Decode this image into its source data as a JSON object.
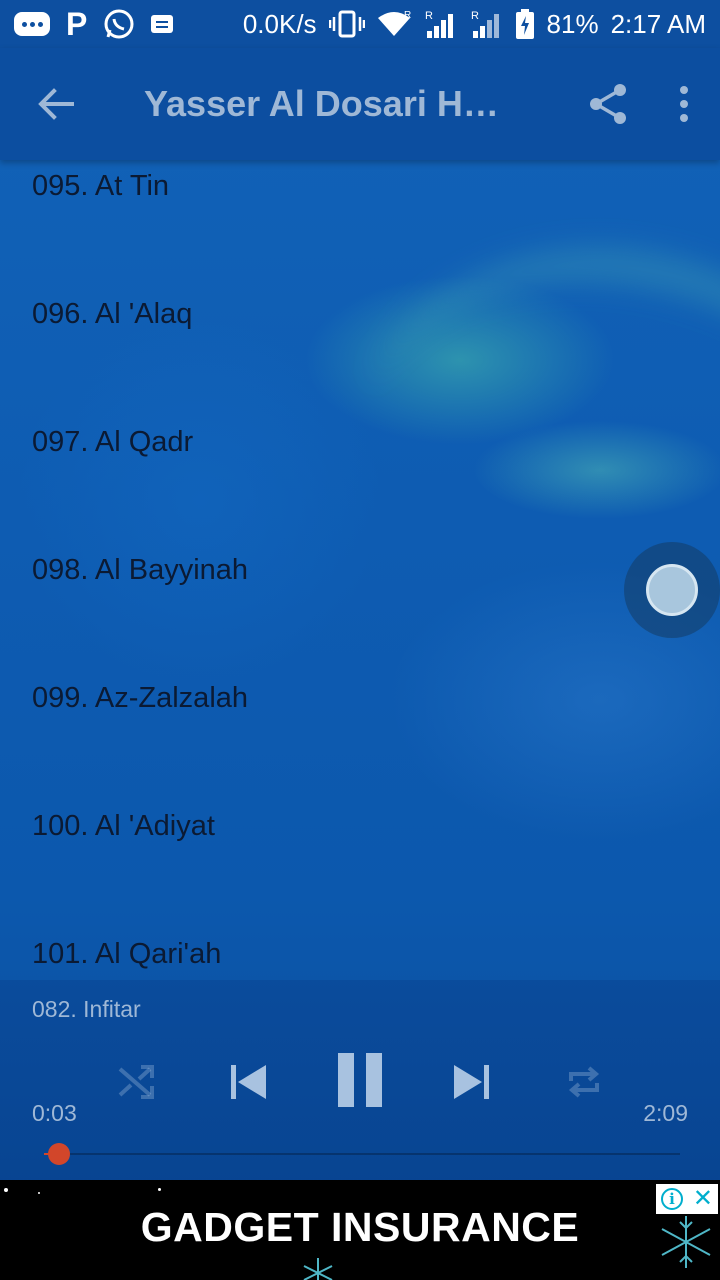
{
  "status_bar": {
    "net_speed": "0.0K/s",
    "battery": "81%",
    "time": "2:17 AM",
    "icons": [
      "chat-icon",
      "p-icon",
      "whatsapp-icon",
      "message-icon",
      "vibrate-icon",
      "wifi-icon",
      "signal-icon",
      "signal-icon",
      "battery-icon"
    ],
    "roaming_marks": [
      "R",
      "R"
    ]
  },
  "app_bar": {
    "title": "Yasser Al Dosari Ho…",
    "back_icon": "arrow-left-icon",
    "share_icon": "share-icon",
    "more_icon": "more-vert-icon"
  },
  "tracks": [
    {
      "label": "095. At Tin"
    },
    {
      "label": "096. Al 'Alaq"
    },
    {
      "label": "097. Al Qadr"
    },
    {
      "label": "098. Al Bayyinah"
    },
    {
      "label": "099. Az-Zalzalah"
    },
    {
      "label": "100. Al 'Adiyat"
    },
    {
      "label": "101. Al Qari'ah"
    }
  ],
  "player": {
    "now_playing": "082. Infitar",
    "current_time": "0:03",
    "total_time": "2:09",
    "progress": 0.023,
    "controls": [
      "shuffle-icon",
      "skip-previous-icon",
      "pause-icon",
      "skip-next-icon",
      "repeat-icon"
    ],
    "accent_color": "#d2462a"
  },
  "ad": {
    "text": "GADGET INSURANCE",
    "info_label": "i",
    "close_label": "✕"
  }
}
